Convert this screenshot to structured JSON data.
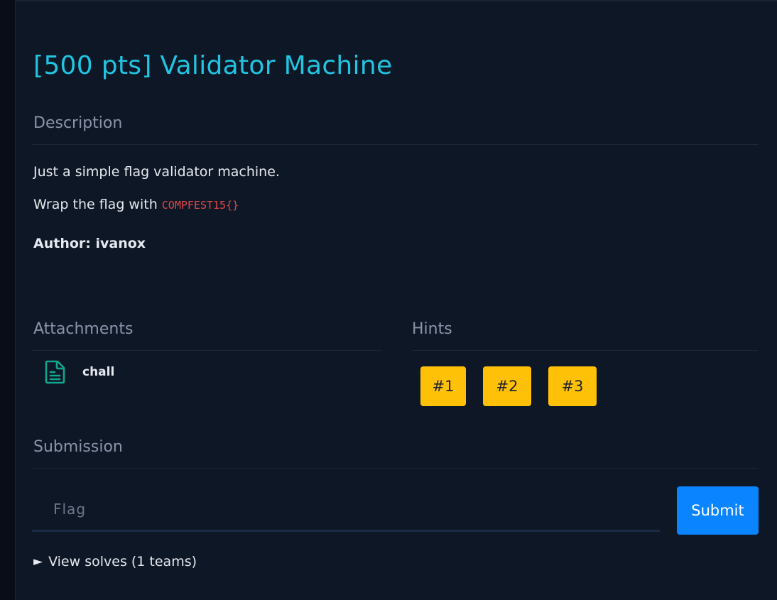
{
  "challenge": {
    "title": "[500 pts] Validator Machine"
  },
  "description": {
    "heading": "Description",
    "line1": "Just a simple flag validator machine.",
    "line2_prefix": "Wrap the flag with ",
    "line2_code": "COMPFEST15{}",
    "author": "Author: ivanox"
  },
  "attachments": {
    "heading": "Attachments",
    "items": [
      {
        "name": "chall",
        "icon": "file-document-icon"
      }
    ]
  },
  "hints": {
    "heading": "Hints",
    "buttons": [
      "#1",
      "#2",
      "#3"
    ]
  },
  "submission": {
    "heading": "Submission",
    "flag_placeholder": "Flag",
    "flag_value": "",
    "submit_label": "Submit"
  },
  "solves": {
    "toggle_icon": "triangle-right-icon",
    "label": "View solves (1 teams)"
  },
  "colors": {
    "title": "#21c4e1",
    "hint_button": "#ffc107",
    "submit_button": "#0a84ff",
    "code_text": "#e0484c",
    "attachment_icon": "#12a58e"
  }
}
